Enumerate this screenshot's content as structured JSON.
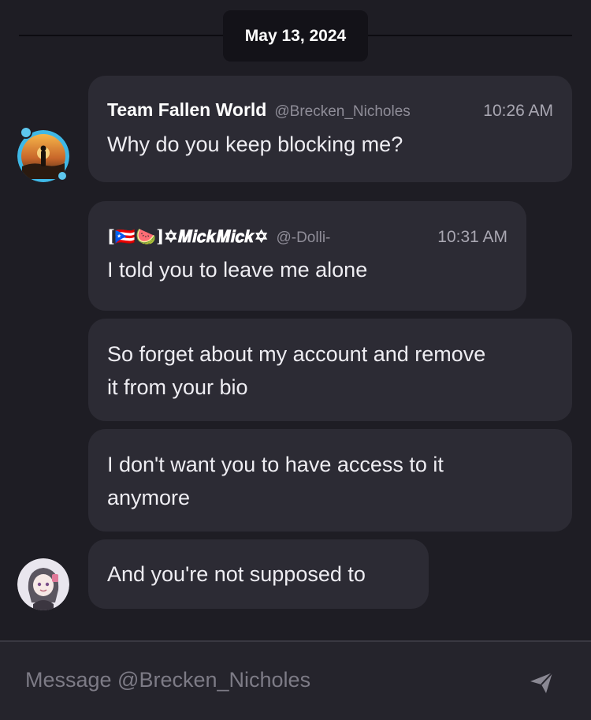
{
  "date_separator": "May 13, 2024",
  "messages": [
    {
      "author": "Team Fallen World",
      "handle": "@Brecken_Nicholes",
      "time": "10:26 AM",
      "lines": [
        "Why do you keep blocking me?"
      ]
    },
    {
      "author": "[🇵🇷🍉]✡𝑴𝒊𝒄𝒌𝑴𝒊𝒄𝒌✡",
      "handle": "@-Dolli-",
      "time": "10:31 AM",
      "lines": [
        "I told you to leave me alone"
      ]
    },
    {
      "lines": [
        "So forget about my account and remove",
        "it from your bio"
      ]
    },
    {
      "lines": [
        "I don't want you to have access to it",
        "anymore"
      ]
    },
    {
      "lines": [
        "And you're not supposed to"
      ]
    }
  ],
  "composer": {
    "placeholder": "Message @Brecken_Nicholes",
    "send_icon": "paper-plane-icon"
  },
  "colors": {
    "background": "#1e1d24",
    "bubble": "#2c2b34",
    "avatar_ring": "#3fb8e6"
  }
}
